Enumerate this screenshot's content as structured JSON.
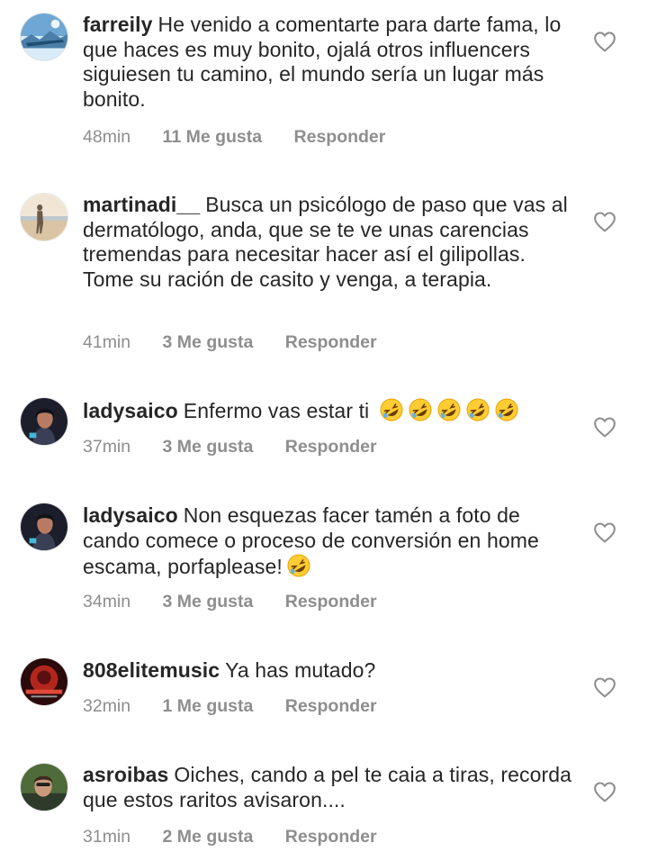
{
  "comments": [
    {
      "username": "farreily",
      "text": "He venido a comentarte para darte fama, lo que haces es muy bonito, ojalá otros influencers siguiesen tu camino, el mundo sería un lugar más bonito.",
      "time": "48min",
      "likes": "11 Me gusta",
      "reply": "Responder",
      "avatar_icon": "sky-landscape-avatar"
    },
    {
      "username": "martinadi__",
      "text": "Busca un psicólogo de paso que vas al dermatólogo, anda, que se te ve unas carencias tremendas para necesitar hacer así el gilipollas. Tome su ración de casito y venga, a terapia.",
      "time": "41min",
      "likes": "3 Me gusta",
      "reply": "Responder",
      "avatar_icon": "beach-silhouette-avatar"
    },
    {
      "username": "ladysaico",
      "text": "Enfermo vas estar ti",
      "emoji_count": 5,
      "emoji": "rolling-on-floor-laughing",
      "time": "37min",
      "likes": "3 Me gusta",
      "reply": "Responder",
      "avatar_icon": "portrait-avatar"
    },
    {
      "username": "ladysaico",
      "text": "Non esquezas facer tamén a  foto de cando comece o proceso de conversión en home escama, porfaplease!",
      "emoji_count": 1,
      "emoji": "rolling-on-floor-laughing",
      "time": "34min",
      "likes": "3 Me gusta",
      "reply": "Responder",
      "avatar_icon": "portrait-avatar"
    },
    {
      "username": "808elitemusic",
      "text": "Ya has mutado?",
      "time": "32min",
      "likes": "1 Me gusta",
      "reply": "Responder",
      "avatar_icon": "red-artwork-avatar"
    },
    {
      "username": "asroibas",
      "text": "Oiches, cando a pel te caia a tiras, recorda que estos raritos avisaron....",
      "time": "31min",
      "likes": "2 Me gusta",
      "reply": "Responder",
      "avatar_icon": "selfie-avatar"
    }
  ],
  "colors": {
    "text": "#262626",
    "meta": "#8e8e8e",
    "background": "#ffffff"
  },
  "icons": {
    "like": "heart-outline-icon"
  }
}
